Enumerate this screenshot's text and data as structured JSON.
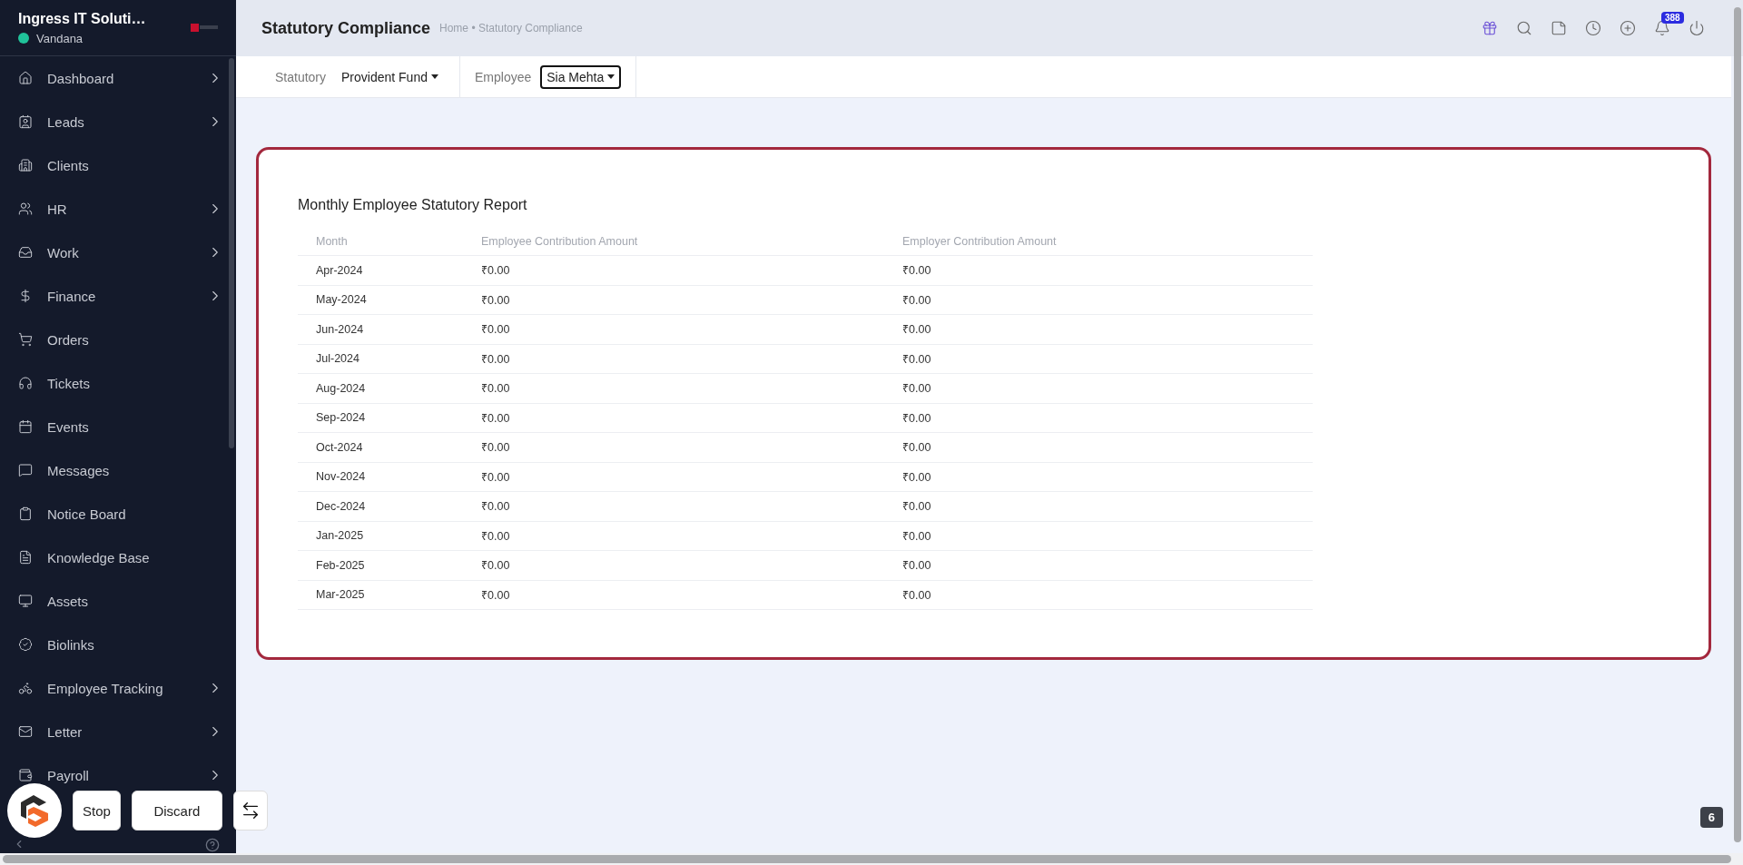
{
  "sidebar": {
    "company": "Ingress IT Soluti…",
    "user": "Vandana",
    "online": true,
    "items": [
      {
        "label": "Dashboard",
        "has_submenu": true
      },
      {
        "label": "Leads",
        "has_submenu": true
      },
      {
        "label": "Clients",
        "has_submenu": false
      },
      {
        "label": "HR",
        "has_submenu": true
      },
      {
        "label": "Work",
        "has_submenu": true
      },
      {
        "label": "Finance",
        "has_submenu": true
      },
      {
        "label": "Orders",
        "has_submenu": false
      },
      {
        "label": "Tickets",
        "has_submenu": false
      },
      {
        "label": "Events",
        "has_submenu": false
      },
      {
        "label": "Messages",
        "has_submenu": false
      },
      {
        "label": "Notice Board",
        "has_submenu": false
      },
      {
        "label": "Knowledge Base",
        "has_submenu": false
      },
      {
        "label": "Assets",
        "has_submenu": false
      },
      {
        "label": "Biolinks",
        "has_submenu": false
      },
      {
        "label": "Employee Tracking",
        "has_submenu": true
      },
      {
        "label": "Letter",
        "has_submenu": true
      },
      {
        "label": "Payroll",
        "has_submenu": true
      }
    ]
  },
  "header": {
    "title": "Statutory Compliance",
    "breadcrumb": "Home • Statutory Compliance",
    "notification_count": "388"
  },
  "filters": [
    {
      "label": "Statutory",
      "value": "Provident Fund",
      "kind": "plain"
    },
    {
      "label": "Employee",
      "value": "Sia Mehta",
      "kind": "outlined"
    }
  ],
  "report": {
    "title": "Monthly Employee Statutory Report",
    "columns": [
      "Month",
      "Employee Contribution Amount",
      "Employer Contribution Amount"
    ],
    "rows": [
      [
        "Apr-2024",
        "₹0.00",
        "₹0.00"
      ],
      [
        "May-2024",
        "₹0.00",
        "₹0.00"
      ],
      [
        "Jun-2024",
        "₹0.00",
        "₹0.00"
      ],
      [
        "Jul-2024",
        "₹0.00",
        "₹0.00"
      ],
      [
        "Aug-2024",
        "₹0.00",
        "₹0.00"
      ],
      [
        "Sep-2024",
        "₹0.00",
        "₹0.00"
      ],
      [
        "Oct-2024",
        "₹0.00",
        "₹0.00"
      ],
      [
        "Nov-2024",
        "₹0.00",
        "₹0.00"
      ],
      [
        "Dec-2024",
        "₹0.00",
        "₹0.00"
      ],
      [
        "Jan-2025",
        "₹0.00",
        "₹0.00"
      ],
      [
        "Feb-2025",
        "₹0.00",
        "₹0.00"
      ],
      [
        "Mar-2025",
        "₹0.00",
        "₹0.00"
      ]
    ]
  },
  "recorder": {
    "buttons": [
      "Stop",
      "Discard"
    ]
  },
  "corner_badge": "6"
}
